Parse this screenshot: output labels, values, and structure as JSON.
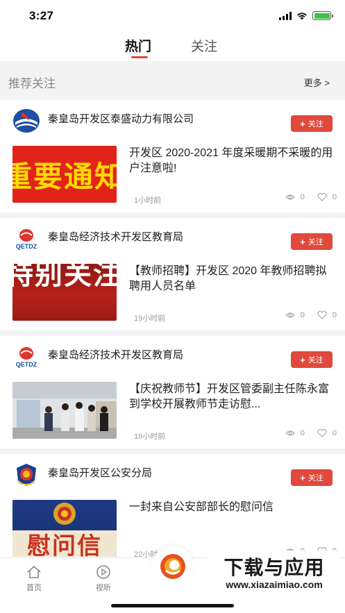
{
  "status": {
    "time": "3:27"
  },
  "tabs": {
    "hot": "热门",
    "follow": "关注"
  },
  "recommend": {
    "title": "推荐关注",
    "more": "更多 >"
  },
  "follow_label": "关注",
  "colors": {
    "accent": "#e0493b",
    "divider": "#f3f3f3"
  },
  "feed": [
    {
      "org": "秦皇岛开发区泰盛动力有限公司",
      "logo_icon": "taisheng-logo-icon",
      "thumb_text": "重要通知",
      "headline": "开发区 2020-2021 年度采暖期不采暖的用户注意啦!",
      "time": "1小时前",
      "views": "0",
      "likes": "0"
    },
    {
      "org": "秦皇岛经济技术开发区教育局",
      "logo_icon": "qetdz-logo-icon",
      "thumb_text": "特别关注",
      "headline": "【教师招聘】开发区 2020 年教师招聘拟聘用人员名单",
      "time": "19小时前",
      "views": "0",
      "likes": "0"
    },
    {
      "org": "秦皇岛经济技术开发区教育局",
      "logo_icon": "qetdz-logo-icon",
      "thumb_text": "",
      "headline": "【庆祝教师节】开发区管委副主任陈永富到学校开展教师节走访慰...",
      "time": "19小时前",
      "views": "0",
      "likes": "0"
    },
    {
      "org": "秦皇岛开发区公安分局",
      "logo_icon": "police-emblem-icon",
      "thumb_text": "慰问信",
      "headline": "一封来自公安部部长的慰问信",
      "time": "22小时前",
      "views": "0",
      "likes": "0"
    }
  ],
  "nav": {
    "home": "首页",
    "video": "视听"
  },
  "watermark": {
    "main": "下载与应用",
    "url": "www.xiazaimiao.com"
  }
}
